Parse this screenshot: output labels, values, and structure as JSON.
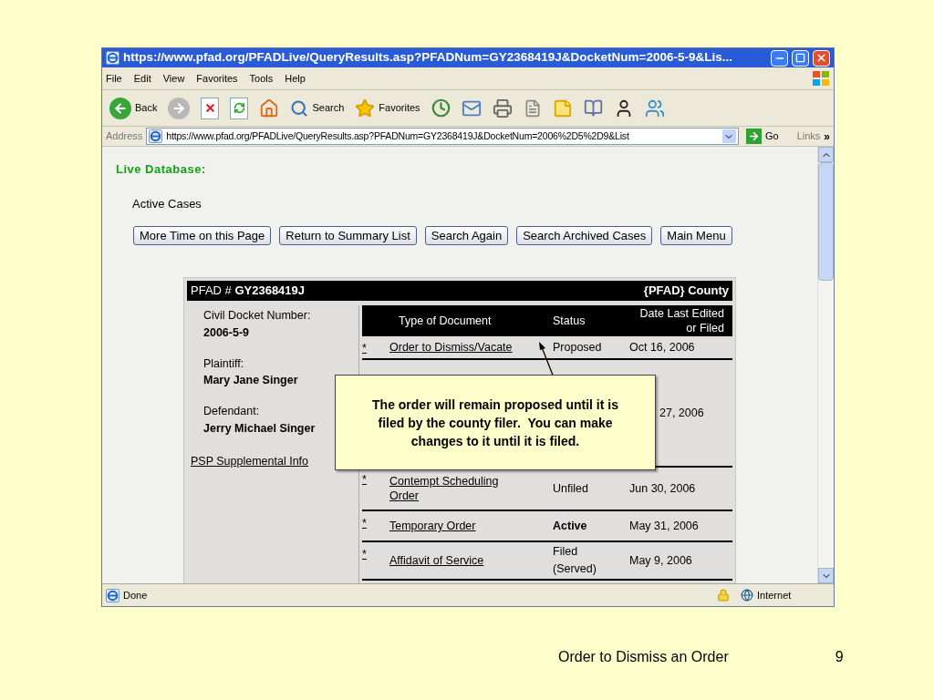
{
  "window": {
    "title": "https://www.pfad.org/PFADLive/QueryResults.asp?PFADNum=GY2368419J&DocketNum=2006-5-9&Lis..."
  },
  "menu": [
    "File",
    "Edit",
    "View",
    "Favorites",
    "Tools",
    "Help"
  ],
  "toolbar": [
    {
      "kind": "back",
      "label": "Back"
    },
    {
      "kind": "forward"
    },
    {
      "kind": "stop"
    },
    {
      "kind": "refresh"
    },
    {
      "kind": "home"
    },
    {
      "kind": "search",
      "label": "Search"
    },
    {
      "kind": "favorites",
      "label": "Favorites"
    },
    {
      "kind": "history"
    },
    {
      "kind": "mail"
    },
    {
      "kind": "print"
    },
    {
      "kind": "edit"
    },
    {
      "kind": "notes"
    },
    {
      "kind": "research"
    },
    {
      "kind": "messenger"
    },
    {
      "kind": "people"
    }
  ],
  "address": {
    "label": "Address",
    "value": "https://www.pfad.org/PFADLive/QueryResults.asp?PFADNum=GY2368419J&DocketNum=2006%2D5%2D9&List",
    "go": "Go",
    "links": "Links",
    "more": "»"
  },
  "page": {
    "heading": "Live Database:",
    "subheading": "Active Cases",
    "buttons": [
      "More Time on this Page",
      "Return to Summary List",
      "Search Again",
      "Search Archived Cases",
      "Main Menu"
    ]
  },
  "case": {
    "label": "PFAD #",
    "number": "GY2368419J",
    "county": "{PFAD} County",
    "fields": [
      {
        "label": "Civil Docket Number:",
        "value": "2006-5-9"
      },
      {
        "label": "Plaintiff:",
        "value": "Mary Jane Singer"
      },
      {
        "label": "Defendant:",
        "value": "Jerry Michael Singer"
      }
    ],
    "link": "PSP Supplemental Info",
    "columns": [
      "Type of Document",
      "Status",
      "Date Last Edited or Filed"
    ],
    "rows": [
      {
        "marker": "*",
        "type": "Order to Dismiss/Vacate",
        "status": "Proposed",
        "date": "Oct 16, 2006",
        "highlighted": false
      },
      {
        "date": "27, 2006"
      },
      {
        "marker": "*",
        "type": "Contempt Scheduling Order",
        "status": "Unfiled",
        "date": "Jun 30, 2006",
        "highlighted": false
      },
      {
        "marker": "*",
        "type": "Temporary Order",
        "status": "Active",
        "date": "May 31, 2006",
        "highlighted": true
      },
      {
        "marker": "*",
        "type": "Affidavit of Service",
        "status": "Filed (Served)",
        "date": "May 9, 2006",
        "highlighted": false
      }
    ]
  },
  "callout": {
    "text": "The order will remain proposed until it is filed by the county filer.  You can make changes to it until it is filed."
  },
  "status_bar": {
    "text": "Done",
    "zone": "Internet"
  },
  "footer": {
    "title": "Order to Dismiss an Order",
    "page": "9"
  }
}
